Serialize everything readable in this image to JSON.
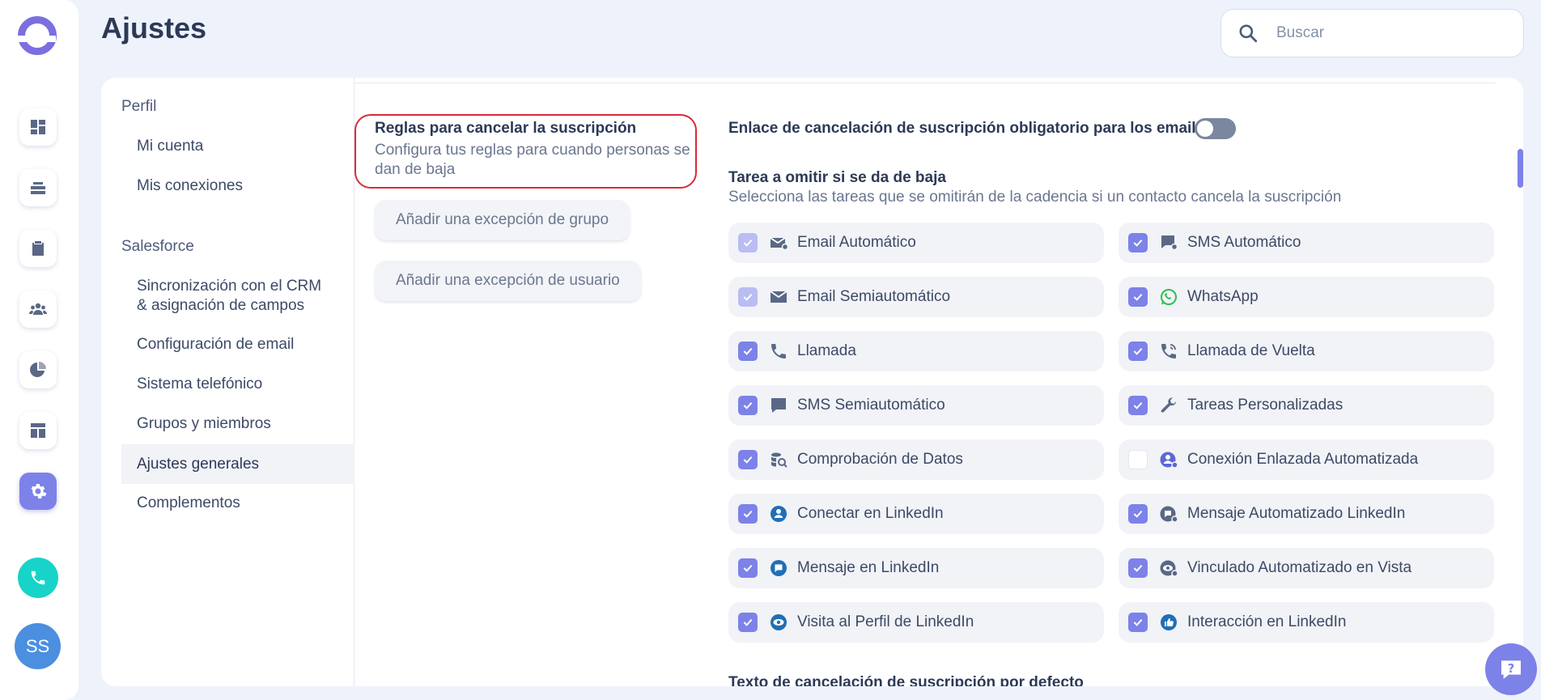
{
  "header": {
    "title": "Ajustes",
    "search_placeholder": "Buscar"
  },
  "user": {
    "initials": "SS"
  },
  "nav": {
    "sections": [
      {
        "label": "Perfil",
        "items": [
          "Mi cuenta",
          "Mis conexiones"
        ]
      },
      {
        "label": "Salesforce",
        "items": [
          "Sincronización con el CRM & asignación de campos",
          "Configuración de email",
          "Sistema telefónico",
          "Grupos y miembros",
          "Ajustes generales",
          "Complementos"
        ]
      }
    ],
    "active_item": "Ajustes generales"
  },
  "rules": {
    "title": "Reglas para cancelar la suscripción",
    "description": "Configura tus reglas para cuando personas se dan de baja",
    "group_exception_button": "Añadir una excepción de grupo",
    "user_exception_button": "Añadir una excepción de usuario"
  },
  "settings": {
    "toggle_label": "Enlace de cancelación de suscripción obligatorio para los emails",
    "toggle_on": false,
    "tasks_title": "Tarea a omitir si se da de baja",
    "tasks_description": "Selecciona las tareas que se omitirán de la cadencia si un contacto cancela la suscripción",
    "tasks": [
      {
        "label": "Email Automático",
        "checked": true,
        "state": "disabled",
        "icon": "email-auto-icon"
      },
      {
        "label": "SMS Automático",
        "checked": true,
        "state": "normal",
        "icon": "sms-auto-icon"
      },
      {
        "label": "Email Semiautomático",
        "checked": true,
        "state": "disabled",
        "icon": "email-icon"
      },
      {
        "label": "WhatsApp",
        "checked": true,
        "state": "normal",
        "icon": "whatsapp-icon"
      },
      {
        "label": "Llamada",
        "checked": true,
        "state": "normal",
        "icon": "phone-icon"
      },
      {
        "label": "Llamada de Vuelta",
        "checked": true,
        "state": "normal",
        "icon": "callback-icon"
      },
      {
        "label": "SMS Semiautomático",
        "checked": true,
        "state": "normal",
        "icon": "chat-icon"
      },
      {
        "label": "Tareas Personalizadas",
        "checked": true,
        "state": "normal",
        "icon": "wrench-icon"
      },
      {
        "label": "Comprobación de Datos",
        "checked": true,
        "state": "normal",
        "icon": "data-check-icon"
      },
      {
        "label": "Conexión Enlazada Automatizada",
        "checked": false,
        "state": "normal",
        "icon": "linkedin-auto-connect-icon"
      },
      {
        "label": "Conectar en LinkedIn",
        "checked": true,
        "state": "normal",
        "icon": "linkedin-connect-icon"
      },
      {
        "label": "Mensaje Automatizado LinkedIn",
        "checked": true,
        "state": "normal",
        "icon": "linkedin-auto-message-icon"
      },
      {
        "label": "Mensaje en LinkedIn",
        "checked": true,
        "state": "normal",
        "icon": "linkedin-message-icon"
      },
      {
        "label": "Vinculado Automatizado en Vista",
        "checked": true,
        "state": "normal",
        "icon": "linkedin-auto-view-icon"
      },
      {
        "label": "Visita al Perfil de LinkedIn",
        "checked": true,
        "state": "normal",
        "icon": "linkedin-view-icon"
      },
      {
        "label": "Interacción en LinkedIn",
        "checked": true,
        "state": "normal",
        "icon": "linkedin-like-icon"
      }
    ],
    "next_section_title": "Texto de cancelación de suscripción por defecto"
  },
  "colors": {
    "accent": "#7c82e8",
    "highlight_border": "#d92a3a",
    "phone": "#18d3c8",
    "avatar": "#4b8fe0"
  }
}
